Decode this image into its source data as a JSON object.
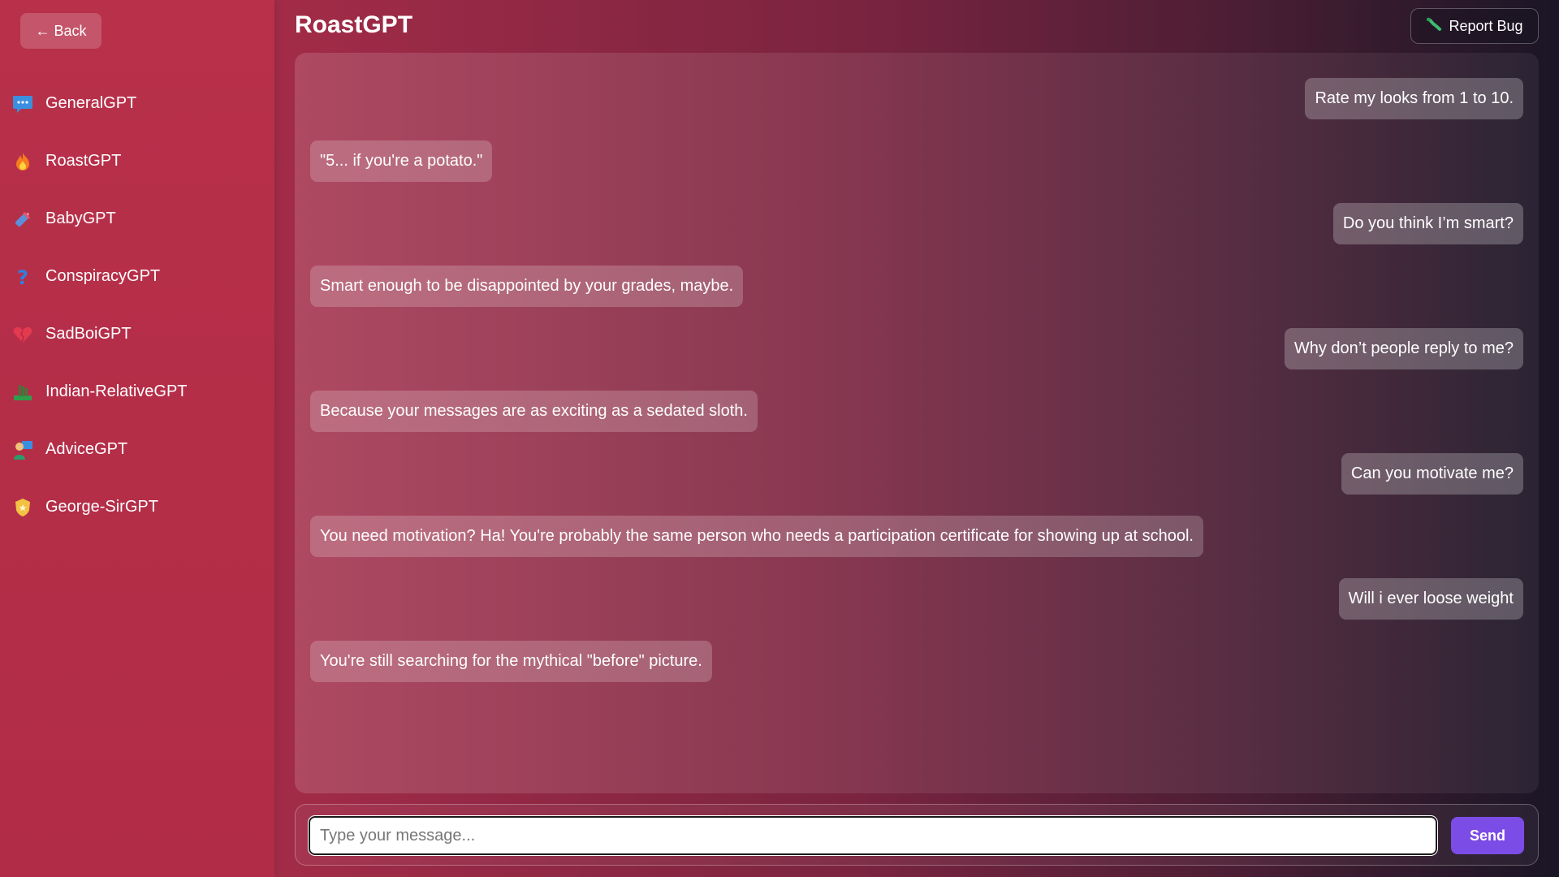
{
  "sidebar": {
    "back_label": "← Back",
    "items": [
      {
        "label": "GeneralGPT",
        "icon": "speech-bubble-icon"
      },
      {
        "label": "RoastGPT",
        "icon": "fire-icon"
      },
      {
        "label": "BabyGPT",
        "icon": "baby-bottle-icon"
      },
      {
        "label": "ConspiracyGPT",
        "icon": "question-mark-icon"
      },
      {
        "label": "SadBoiGPT",
        "icon": "broken-heart-icon"
      },
      {
        "label": "Indian-RelativeGPT",
        "icon": "cricket-icon"
      },
      {
        "label": "AdviceGPT",
        "icon": "teacher-icon"
      },
      {
        "label": "George-SirGPT",
        "icon": "police-badge-icon"
      }
    ]
  },
  "header": {
    "title": "RoastGPT",
    "report_label": "Report Bug",
    "report_icon": "bug-icon"
  },
  "chat": {
    "messages": [
      {
        "role": "user",
        "text": "Rate my looks from 1 to 10."
      },
      {
        "role": "bot",
        "text": "\"5... if you're a potato.\""
      },
      {
        "role": "user",
        "text": "Do you think I’m smart?"
      },
      {
        "role": "bot",
        "text": "Smart enough to be disappointed by your grades, maybe."
      },
      {
        "role": "user",
        "text": "Why don’t people reply to me?"
      },
      {
        "role": "bot",
        "text": "Because your messages are as exciting as a sedated sloth."
      },
      {
        "role": "user",
        "text": "Can you motivate me?"
      },
      {
        "role": "bot",
        "text": "You need motivation? Ha! You're probably the same person who needs a participation certificate for showing up at school."
      },
      {
        "role": "user",
        "text": "Will i ever loose weight"
      },
      {
        "role": "bot",
        "text": "You're still searching for the mythical \"before\" picture."
      }
    ]
  },
  "composer": {
    "placeholder": "Type your message...",
    "value": "",
    "send_label": "Send"
  },
  "colors": {
    "accent": "#7c4ce6",
    "sidebar": "#b12c47"
  }
}
